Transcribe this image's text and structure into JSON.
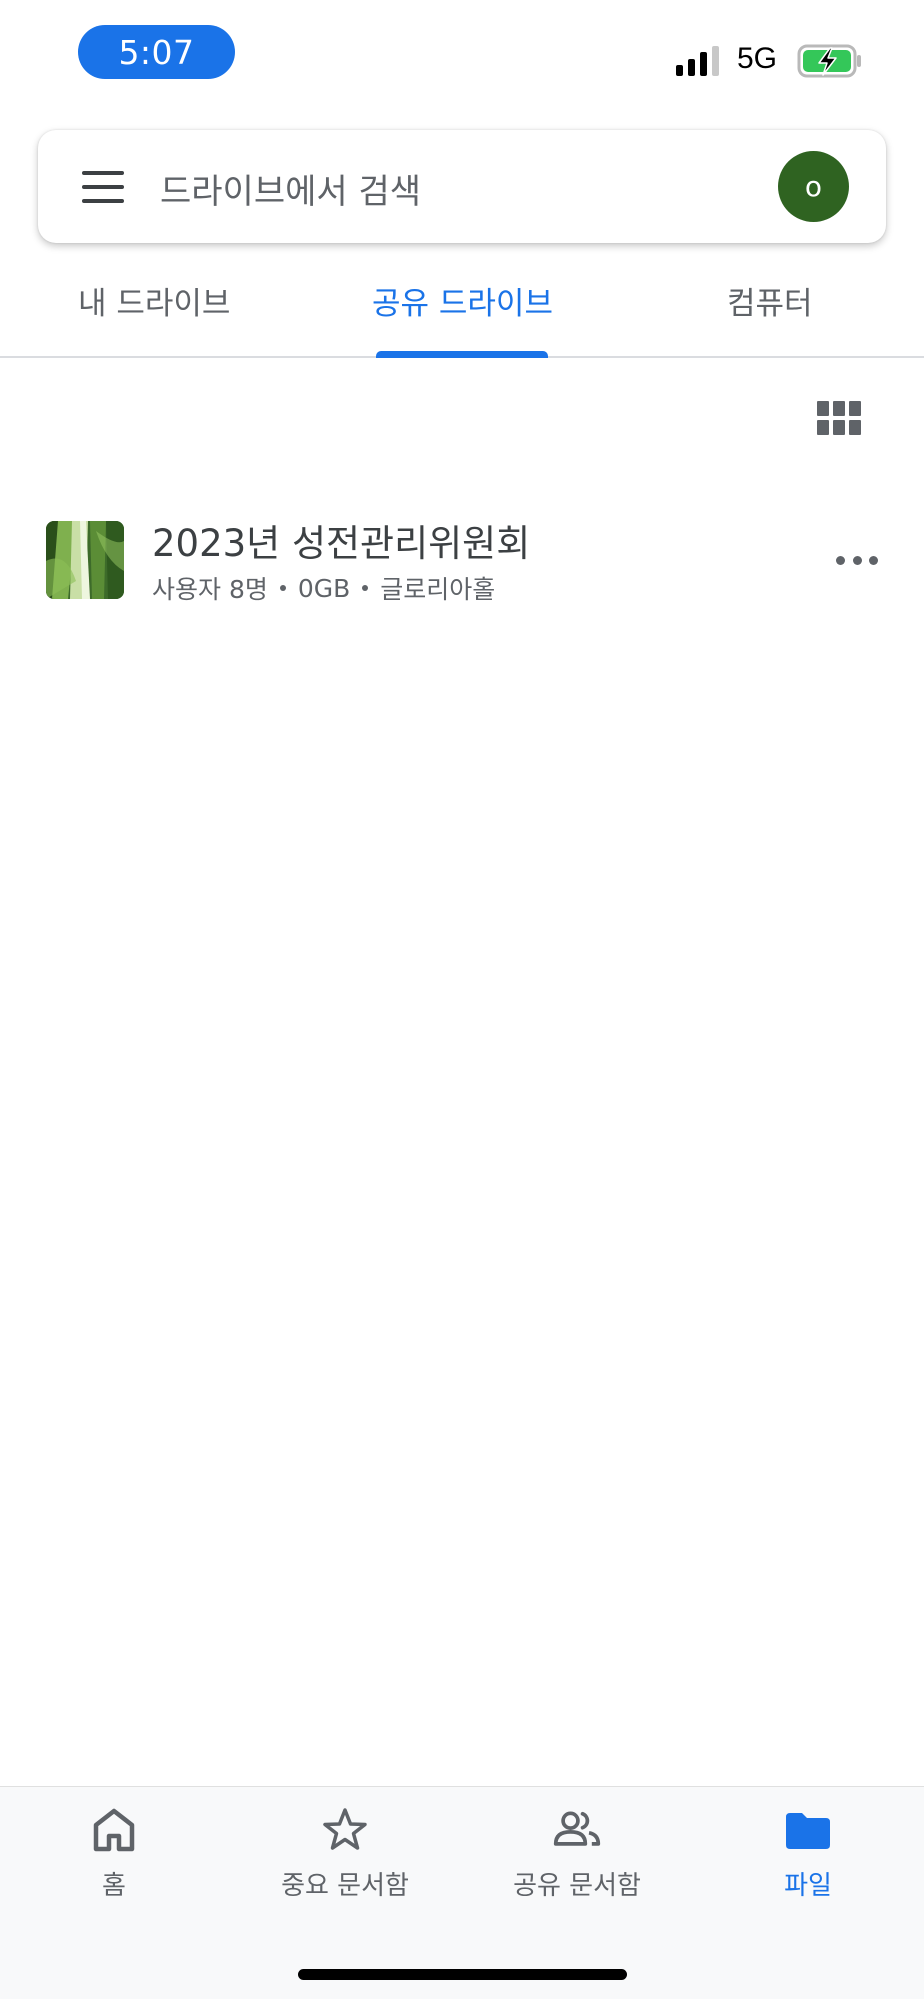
{
  "status_bar": {
    "time": "5:07",
    "network": "5G",
    "battery_color": "#34c759"
  },
  "search": {
    "placeholder": "드라이브에서 검색",
    "avatar_letter": "o",
    "avatar_color": "#2f6321"
  },
  "tabs": [
    {
      "label": "내 드라이브",
      "active": false
    },
    {
      "label": "공유 드라이브",
      "active": true
    },
    {
      "label": "컴퓨터",
      "active": false
    }
  ],
  "view_toggle": {
    "icon": "grid-view-icon"
  },
  "drives": [
    {
      "title": "2023년 성전관리위원회",
      "users": "사용자 8명",
      "size": "0GB",
      "owner": "글로리아홀",
      "thumbnail": "green-leaf-thumbnail"
    }
  ],
  "bottom_nav": [
    {
      "label": "홈",
      "icon": "home-icon",
      "active": false
    },
    {
      "label": "중요 문서함",
      "icon": "star-icon",
      "active": false
    },
    {
      "label": "공유 문서함",
      "icon": "people-icon",
      "active": false
    },
    {
      "label": "파일",
      "icon": "folder-icon",
      "active": true
    }
  ],
  "colors": {
    "accent": "#1a73e8",
    "text_secondary": "#5f6368"
  }
}
